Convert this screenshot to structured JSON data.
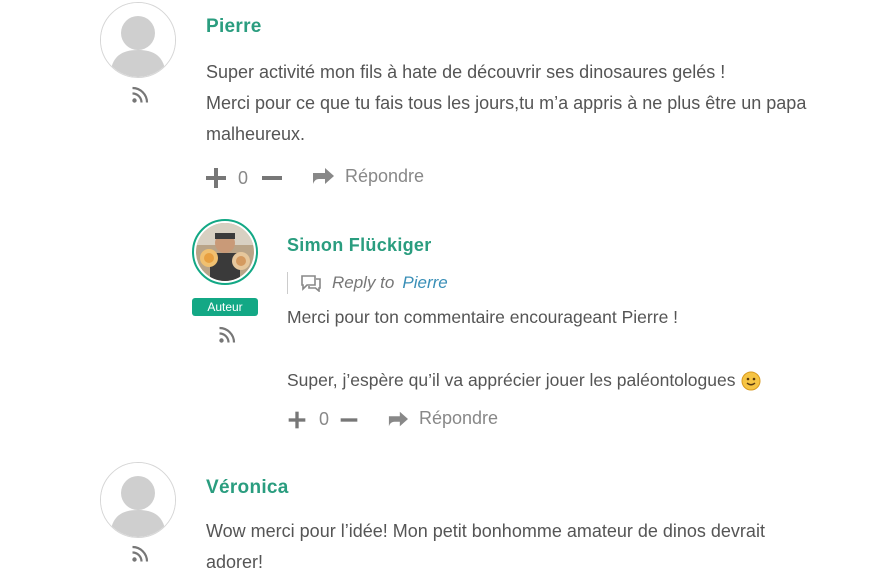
{
  "comments": [
    {
      "author": "Pierre",
      "lines": [
        "Super activité mon fils à hate de découvrir ses dinosaures gelés !",
        "Merci pour ce que tu fais tous les jours,tu m’a appris à ne plus être un papa",
        "malheureux."
      ],
      "votes": "0",
      "reply_label": "Répondre"
    },
    {
      "author": "Simon Flückiger",
      "badge": "Auteur",
      "reply_to_label": "Reply to",
      "reply_to_name": "Pierre",
      "line1": "Merci pour ton commentaire encourageant Pierre !",
      "line2": "Super, j’espère qu’il va apprécier jouer les paléontologues",
      "votes": "0",
      "reply_label": "Répondre"
    },
    {
      "author": "Véronica",
      "lines": [
        "Wow merci pour l’idée! Mon petit bonhomme amateur de dinos devrait",
        "adorer!"
      ]
    }
  ],
  "colors": {
    "author_name": "#2a9d7f",
    "badge_bg": "#13a885",
    "link": "#3a8fb7"
  },
  "icons": [
    "user-silhouette-icon",
    "rss-icon",
    "plus-icon",
    "minus-icon",
    "reply-arrow-icon",
    "speech-bubble-icon",
    "smiley-icon"
  ]
}
